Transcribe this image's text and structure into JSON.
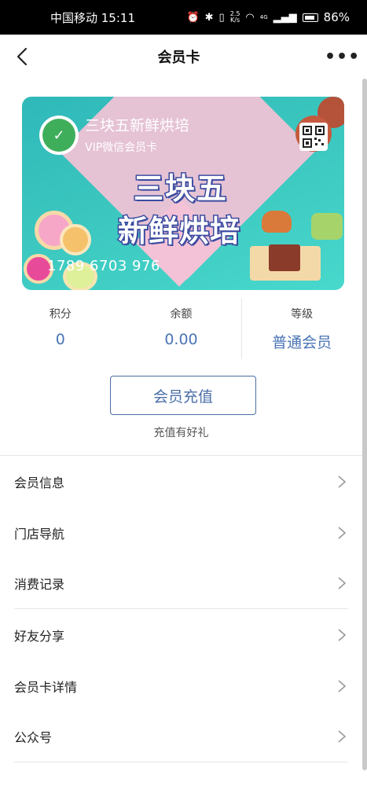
{
  "status_bar": {
    "carrier_time": "中国移动 15:11",
    "network_speed_top": "2.5",
    "network_speed_unit": "K/s",
    "signal_label": "4G",
    "battery": "86%"
  },
  "nav": {
    "title": "会员卡",
    "back_icon": "chevron-left-icon",
    "more_icon": "more-dots-icon"
  },
  "card": {
    "shop_name": "三块五新鲜烘培",
    "card_type": "VIP微信会员卡",
    "headline_1": "三块五",
    "headline_2": "新鲜烘培",
    "card_number": "1789 6703 976",
    "logo_text": "",
    "colors": {
      "background": "#3cc8c0",
      "diamond": "#f4c2d6",
      "headline_stroke": "#3a4aa0"
    }
  },
  "stats": {
    "points_label": "积分",
    "points_value": "0",
    "balance_label": "余额",
    "balance_value": "0.00",
    "level_label": "等级",
    "level_value": "普通会员"
  },
  "recharge": {
    "button_label": "会员充值",
    "tip": "充值有好礼"
  },
  "menu": {
    "items": [
      {
        "label": "会员信息"
      },
      {
        "label": "门店导航"
      },
      {
        "label": "消费记录"
      },
      {
        "label": "好友分享"
      },
      {
        "label": "会员卡详情"
      },
      {
        "label": "公众号"
      }
    ]
  },
  "accent_color": "#4a74b6"
}
